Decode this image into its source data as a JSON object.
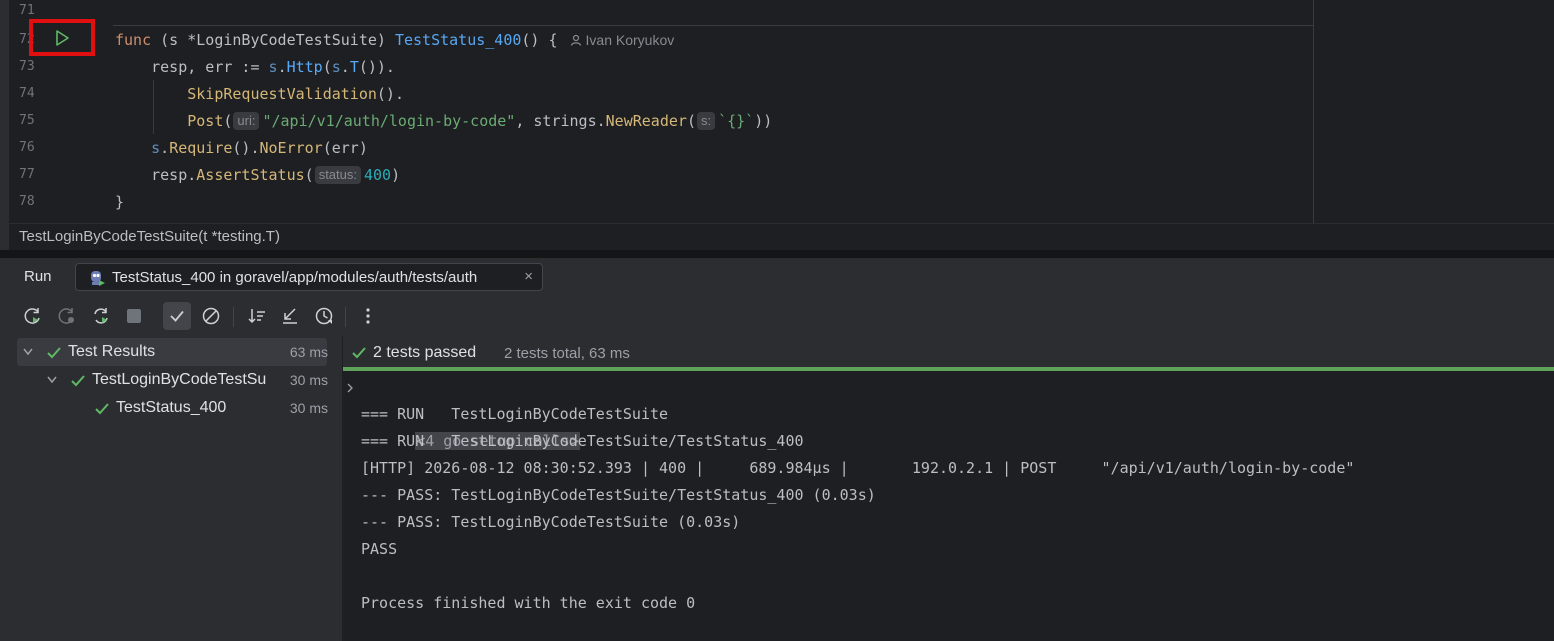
{
  "editor": {
    "line_numbers": [
      "71",
      "72",
      "73",
      "74",
      "75",
      "76",
      "77",
      "78"
    ],
    "code": {
      "l72": {
        "kw": "func",
        "recv_open": " (s *",
        "recv_type": "LoginByCodeTestSuite",
        "recv_close": ") ",
        "name": "TestStatus_400",
        "tail": "() {",
        "author": "Ivan Koryukov"
      },
      "l73": {
        "a": "resp, err := ",
        "s": "s",
        "dot1": ".",
        "http": "Http",
        "p1": "(",
        "s2": "s",
        "dot2": ".",
        "t": "T",
        "tail": "())."
      },
      "l74": {
        "call": "SkipRequestValidation",
        "tail": "()."
      },
      "l75": {
        "call": "Post",
        "p": "(",
        "hint": "uri:",
        "str": "\"/api/v1/auth/login-by-code\"",
        "comma": ", strings.",
        "reader": "NewReader",
        "p2": "(",
        "hint2": "s:",
        "str2": "`{}`",
        "tail": "))"
      },
      "l76": {
        "s": "s",
        "d": ".",
        "req": "Require",
        "mid": "().",
        "noerr": "NoError",
        "tail": "(err)"
      },
      "l77": {
        "a": "resp.",
        "assert": "AssertStatus",
        "p": "(",
        "hint": "status:",
        "num": "400",
        "tail": ")"
      },
      "l78": {
        "brace": "}"
      }
    },
    "breadcrumb": "TestLoginByCodeTestSuite(t *testing.T)"
  },
  "run_window": {
    "title": "Run",
    "tab": {
      "label": "TestStatus_400 in goravel/app/modules/auth/tests/auth",
      "close": "×"
    },
    "toolbar": [
      "rerun-icon",
      "rerun-failed-icon",
      "rerun-auto-icon",
      "stop-icon",
      "show-passed-icon",
      "show-ignored-icon",
      "sort-icon",
      "collapse-icon",
      "history-icon",
      "more-icon"
    ],
    "tree": [
      {
        "label": "Test Results",
        "duration": "63 ms"
      },
      {
        "label": "TestLoginByCodeTestSu",
        "duration": "30 ms"
      },
      {
        "label": "TestStatus_400",
        "duration": "30 ms"
      }
    ],
    "status": {
      "passed": "2 tests passed",
      "total": "2 tests total, 63 ms"
    },
    "console": {
      "fold": "<4 go setup calls>",
      "lines": [
        "=== RUN   TestLoginByCodeTestSuite",
        "=== RUN   TestLoginByCodeTestSuite/TestStatus_400",
        "[HTTP] 2026-08-12 08:30:52.393 | 400 |     689.984µs |       192.0.2.1 | POST     \"/api/v1/auth/login-by-code\"",
        "--- PASS: TestLoginByCodeTestSuite/TestStatus_400 (0.03s)",
        "--- PASS: TestLoginByCodeTestSuite (0.03s)",
        "PASS",
        "",
        "Process finished with the exit code 0"
      ]
    }
  },
  "colors": {
    "pass_green": "#5fa35a",
    "highlight_red": "#e01010",
    "background": "#1e1f22"
  }
}
